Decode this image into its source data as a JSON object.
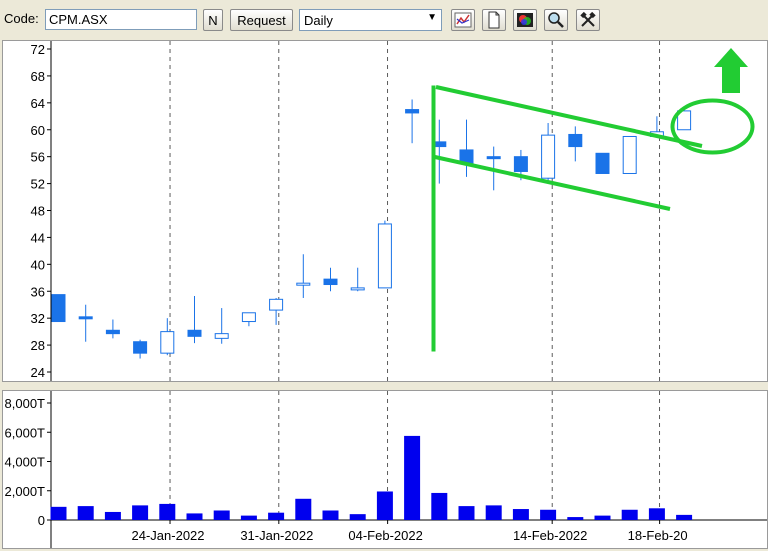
{
  "toolbar": {
    "code_label": "Code:",
    "code_value": "CPM.ASX",
    "n_button": "N",
    "request_button": "Request",
    "period_value": "Daily",
    "icons": [
      "chart-icon",
      "document-icon",
      "palette-icon",
      "zoom-icon",
      "tools-icon"
    ]
  },
  "colors": {
    "candle_down": "#1a73e8",
    "candle_up_outline": "#1a73e8",
    "volume_bar": "#0000ee",
    "annotation": "#22cc33"
  },
  "chart_data": [
    {
      "type": "candlestick",
      "ylim": [
        24,
        72
      ],
      "yticks": [
        24,
        28,
        32,
        36,
        40,
        44,
        48,
        52,
        56,
        60,
        64,
        68,
        72
      ],
      "grid": "dashed vertical at date labels",
      "candles": [
        {
          "o": 35.5,
          "h": 35.5,
          "l": 31.5,
          "c": 31.5
        },
        {
          "o": 32.2,
          "h": 34.0,
          "l": 28.5,
          "c": 32.0
        },
        {
          "o": 30.2,
          "h": 31.8,
          "l": 29.0,
          "c": 29.7
        },
        {
          "o": 28.5,
          "h": 28.8,
          "l": 26.0,
          "c": 26.8
        },
        {
          "o": 26.8,
          "h": 32.0,
          "l": 26.5,
          "c": 30.0
        },
        {
          "o": 30.2,
          "h": 35.3,
          "l": 28.3,
          "c": 29.3
        },
        {
          "o": 29.0,
          "h": 33.5,
          "l": 28.2,
          "c": 29.7
        },
        {
          "o": 31.5,
          "h": 32.8,
          "l": 30.8,
          "c": 32.8
        },
        {
          "o": 33.2,
          "h": 35.0,
          "l": 31.0,
          "c": 34.8
        },
        {
          "o": 37.2,
          "h": 41.5,
          "l": 35.0,
          "c": 37.2
        },
        {
          "o": 37.8,
          "h": 39.5,
          "l": 36.0,
          "c": 37.0
        },
        {
          "o": 36.5,
          "h": 39.5,
          "l": 36.0,
          "c": 36.5
        },
        {
          "o": 36.5,
          "h": 46.5,
          "l": 36.5,
          "c": 46.0
        },
        {
          "o": 63.0,
          "h": 64.5,
          "l": 58.0,
          "c": 62.5
        },
        {
          "o": 58.2,
          "h": 61.5,
          "l": 52.0,
          "c": 57.5
        },
        {
          "o": 57.0,
          "h": 61.5,
          "l": 53.0,
          "c": 55.0
        },
        {
          "o": 56.0,
          "h": 57.5,
          "l": 51.0,
          "c": 55.8
        },
        {
          "o": 56.0,
          "h": 57.0,
          "l": 52.5,
          "c": 53.8
        },
        {
          "o": 52.8,
          "h": 61.0,
          "l": 52.2,
          "c": 59.2
        },
        {
          "o": 59.3,
          "h": 60.5,
          "l": 55.3,
          "c": 57.5
        },
        {
          "o": 56.5,
          "h": 56.5,
          "l": 53.5,
          "c": 53.5
        },
        {
          "o": 53.5,
          "h": 59.0,
          "l": 53.5,
          "c": 59.0
        },
        {
          "o": 59.0,
          "h": 62.0,
          "l": 59.0,
          "c": 59.7
        },
        {
          "o": 60.0,
          "h": 63.0,
          "l": 60.0,
          "c": 62.8
        }
      ]
    },
    {
      "type": "bar",
      "ylim": [
        0,
        8000
      ],
      "yticks": [
        {
          "value": 0,
          "label": "0"
        },
        {
          "value": 2000,
          "label": "2,000T"
        },
        {
          "value": 4000,
          "label": "4,000T"
        },
        {
          "value": 6000,
          "label": "6,000T"
        },
        {
          "value": 8000,
          "label": "8,000T"
        }
      ],
      "values": [
        900,
        950,
        550,
        1000,
        1100,
        450,
        650,
        300,
        500,
        1450,
        650,
        400,
        1950,
        5750,
        1850,
        950,
        1000,
        750,
        700,
        200,
        300,
        700,
        800,
        350
      ],
      "xticks": [
        {
          "index": 4.1,
          "label": "24-Jan-2022"
        },
        {
          "index": 8.1,
          "label": "31-Jan-2022"
        },
        {
          "index": 12.1,
          "label": "04-Feb-2022"
        },
        {
          "index": 18.15,
          "label": "14-Feb-2022"
        },
        {
          "index": 22.1,
          "label": "18-Feb-20"
        }
      ]
    }
  ]
}
